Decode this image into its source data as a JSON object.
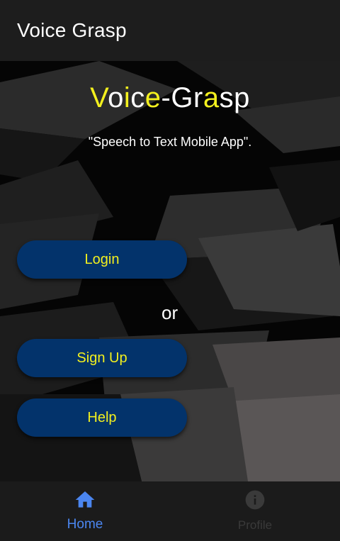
{
  "appbar": {
    "title": "Voice Grasp"
  },
  "hero": {
    "title_parts": [
      {
        "text": "V",
        "highlight": true
      },
      {
        "text": "o",
        "highlight": false
      },
      {
        "text": "i",
        "highlight": true
      },
      {
        "text": "c",
        "highlight": false
      },
      {
        "text": "e",
        "highlight": true
      },
      {
        "text": "-Gr",
        "highlight": false
      },
      {
        "text": "a",
        "highlight": true
      },
      {
        "text": "sp",
        "highlight": false
      }
    ],
    "subtitle": "\"Speech to Text Mobile App\"."
  },
  "actions": {
    "login_label": "Login",
    "or_label": "or",
    "signup_label": "Sign Up",
    "help_label": "Help"
  },
  "bottom_nav": {
    "items": [
      {
        "label": "Home",
        "icon": "home-icon",
        "active": true
      },
      {
        "label": "Profile",
        "icon": "info-icon",
        "active": false
      }
    ]
  },
  "colors": {
    "accent_yellow": "#f3f01e",
    "button_blue": "#03336b",
    "nav_active": "#4b86f0",
    "nav_inactive": "#3a3a3a",
    "appbar_bg": "#1d1d1d"
  }
}
